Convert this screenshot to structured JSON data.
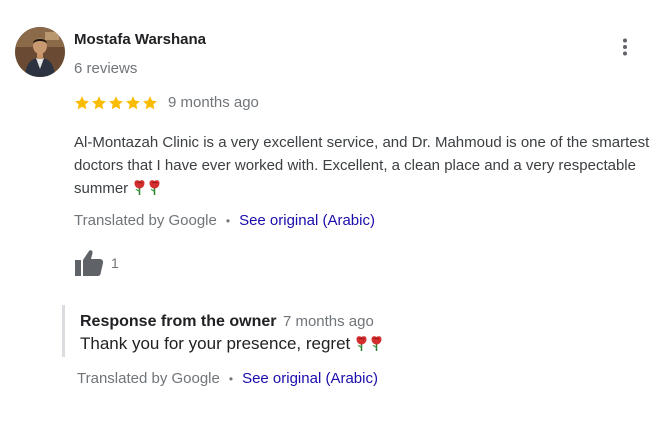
{
  "reviewer": {
    "name": "Mostafa Warshana",
    "reviews_count": "6 reviews"
  },
  "review": {
    "rating": 5,
    "max_rating": 5,
    "star_color": "#fbbc04",
    "time": "9 months ago",
    "text": "Al-Montazah Clinic is a very excellent service, and Dr. Mahmoud is one of the smartest doctors that I have ever worked with. Excellent, a clean place and a very respectable summer",
    "translated_label": "Translated by Google",
    "see_original_label": "See original (Arabic)",
    "likes": "1"
  },
  "owner_response": {
    "title": "Response from the owner",
    "time": "7 months ago",
    "text": "Thank you for your presence, regret",
    "translated_label": "Translated by Google",
    "see_original_label": "See original (Arabic)"
  },
  "icons": {
    "more": "more-vert-icon",
    "like": "thumb-up-icon",
    "star": "star-icon",
    "rose": "rose-emoji-icon"
  },
  "colors": {
    "link": "#1a0dab",
    "secondary_text": "#70757a",
    "star": "#fbbc04"
  }
}
